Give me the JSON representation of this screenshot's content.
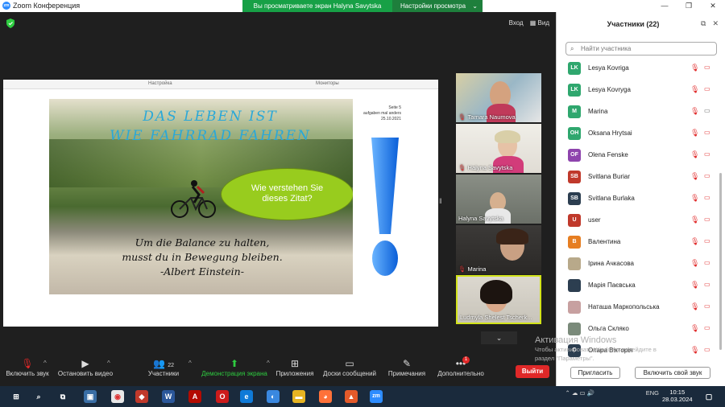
{
  "window": {
    "app_title": "Zoom Конференция",
    "share_banner": "Вы просматриваете экран Halyna Savytska",
    "view_settings": "Настройки просмотра",
    "controls": [
      "—",
      "❐",
      "✕"
    ]
  },
  "view_buttons": {
    "enter": "Вход",
    "view": "Вид"
  },
  "shared_screen": {
    "ruler_left": "Настройка",
    "ruler_right": "Мониторы",
    "slide": {
      "title_line1": "DAS LEBEN IST",
      "title_line2": "WIE FAHRRAD FAHREN",
      "bubble_line1": "Wie verstehen Sie",
      "bubble_line2": "dieses Zitat?",
      "quote_line1": "Um die Balance zu halten,",
      "quote_line2": "musst du in Bewegung bleiben.",
      "quote_line3": "-Albert Einstein-",
      "seite_line1": "Seite 5",
      "seite_line2": "aufgaben mal anders",
      "seite_line3": "25.10.2021",
      "accent_color": "#98cc1e",
      "title_color": "#2aa8d8"
    }
  },
  "video_thumbs": [
    {
      "name": "Tamara Naumova",
      "muted": true
    },
    {
      "name": "Halyna Savytska",
      "muted": true
    },
    {
      "name": "Halyna Savytska",
      "muted": false
    },
    {
      "name": "Marina",
      "muted": true
    },
    {
      "name": "Ludmyla Shelest Tscherk...",
      "muted": false
    }
  ],
  "toolbar": {
    "mute_label": "Включить звук",
    "video_label": "Остановить видео",
    "participants_label": "Участники",
    "participants_count": "22",
    "share_label": "Демонстрация экрана",
    "apps_label": "Приложения",
    "whiteboard_label": "Доски сообщений",
    "notes_label": "Примечания",
    "more_label": "Дополнительно",
    "more_badge": "1",
    "leave_label": "Выйти"
  },
  "panel": {
    "title": "Участники (22)",
    "search_placeholder": "Найти участника",
    "participants": [
      {
        "initials": "LK",
        "name": "Lesya Kovriga",
        "color": "#2fa76e",
        "cam_off": true
      },
      {
        "initials": "LK",
        "name": "Lesya Kovryga",
        "color": "#2fa76e",
        "cam_off": true
      },
      {
        "initials": "M",
        "name": "Marina",
        "color": "#2fa76e",
        "cam_off": false
      },
      {
        "initials": "OH",
        "name": "Oksana Hrytsai",
        "color": "#2fa76e",
        "cam_off": true
      },
      {
        "initials": "OF",
        "name": "Olena Fenske",
        "color": "#8e44ad",
        "cam_off": true
      },
      {
        "initials": "SB",
        "name": "Svitlana Buriar",
        "color": "#c0392b",
        "cam_off": true
      },
      {
        "initials": "SB",
        "name": "Svitlana Burlaka",
        "color": "#2c3e50",
        "cam_off": true
      },
      {
        "initials": "U",
        "name": "user",
        "color": "#c0392b",
        "cam_off": true
      },
      {
        "initials": "В",
        "name": "Валентина",
        "color": "#e67e22",
        "cam_off": true
      },
      {
        "initials": "",
        "name": "Ірина Ачкасова",
        "color": "#b8a98a",
        "cam_off": true
      },
      {
        "initials": "",
        "name": "Марія Паєвська",
        "color": "#2c3e50",
        "cam_off": true
      },
      {
        "initials": "",
        "name": "Наташа Маркопольська",
        "color": "#c7a0a0",
        "cam_off": true
      },
      {
        "initials": "",
        "name": "Ольга Скляко",
        "color": "#7a8a7a",
        "cam_off": true
      },
      {
        "initials": "О",
        "name": "Опара Вікторія",
        "color": "#2c3e50",
        "cam_off": true
      }
    ],
    "invite_label": "Пригласить",
    "unmute_me_label": "Включить свой звук"
  },
  "windows_activation": {
    "line1": "Активация Windows",
    "line2": "Чтобы активировать Windows, перейдите в",
    "line3": "раздел \"Параметры\"."
  },
  "taskbar": {
    "language": "ENG",
    "time": "10:15",
    "date": "28.03.2024"
  }
}
